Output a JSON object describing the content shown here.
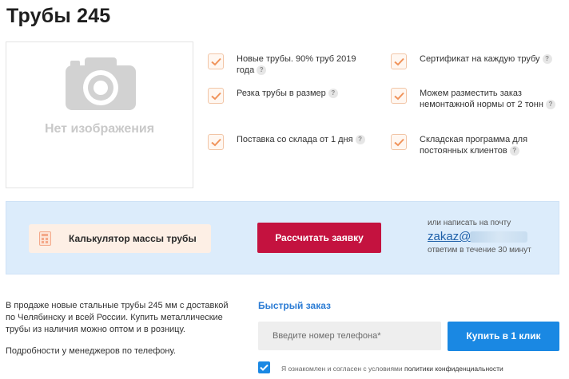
{
  "page": {
    "title": "Трубы 245"
  },
  "image_placeholder": {
    "text": "Нет изображения",
    "icon": "camera-icon"
  },
  "features": [
    {
      "text": "Новые трубы. 90% труб 2019 года",
      "help": "?"
    },
    {
      "text": "Сертификат на каждую трубу",
      "help": "?"
    },
    {
      "text": "Резка трубы в размер",
      "help": "?"
    },
    {
      "text": "Можем разместить заказ немонтажной нормы от 2 тонн",
      "help": "?"
    },
    {
      "text": "Поставка со склада от 1 дня",
      "help": "?"
    },
    {
      "text": "Складская программа для постоянных клиентов",
      "help": "?"
    }
  ],
  "band": {
    "calculator_label": "Калькулятор массы трубы",
    "submit_label": "Рассчитать заявку",
    "mail_hint": "или написать на почту",
    "mail": "zakaz@",
    "reply_hint": "ответим в течение 30 минут"
  },
  "description": {
    "text": "В продаже новые стальные трубы 245 мм с доставкой по Челябинску и всей России. Купить металлические трубы из наличия можно оптом и в розницу.",
    "details": "Подробности у менеджеров по телефону."
  },
  "quick_order": {
    "title": "Быстрый заказ",
    "phone_placeholder": "Введите номер телефона*",
    "buy_label": "Купить в 1 клик",
    "agree_text": "Я ознакомлен и согласен с условиями",
    "agree_link": "политики конфиденциальности",
    "agree_checked": true
  },
  "colors": {
    "accent_red": "#c4123f",
    "accent_blue": "#1a88e3",
    "band_bg": "#dcecfb",
    "check_orange": "#f0935a"
  }
}
